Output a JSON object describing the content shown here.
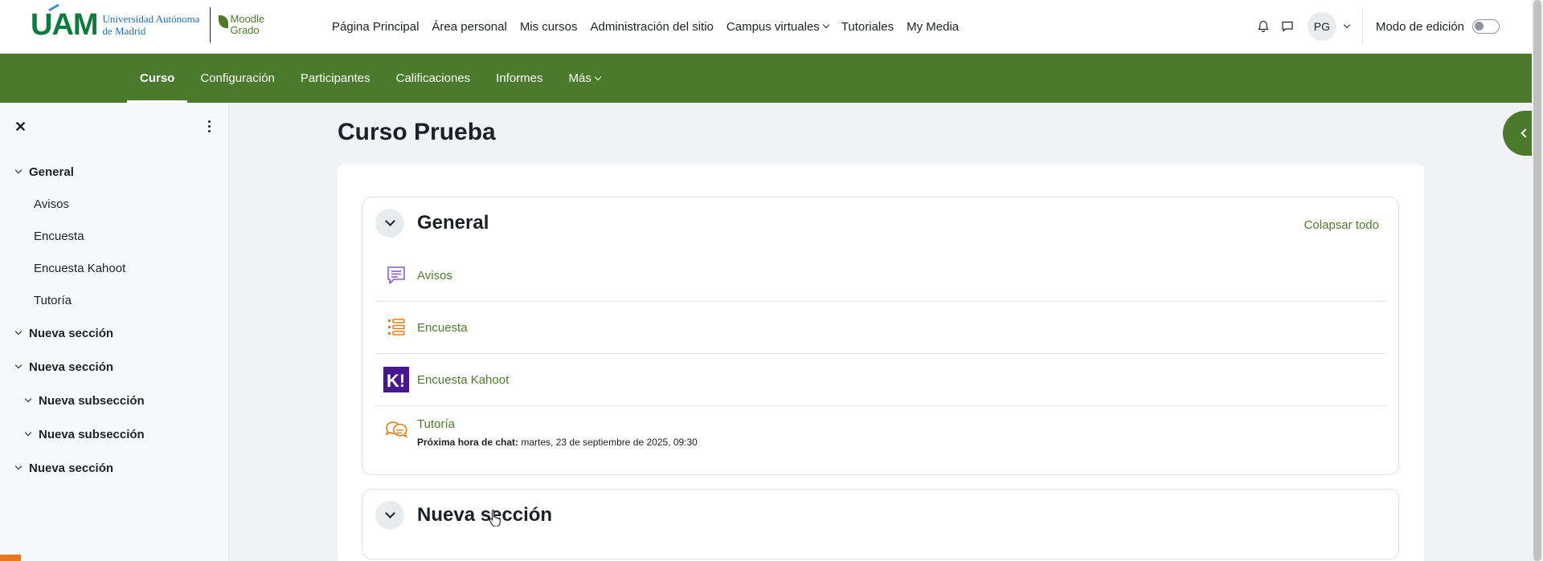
{
  "topbar": {
    "logo": {
      "uam": "UAM",
      "university_line1": "Universidad Autónoma",
      "university_line2": "de Madrid",
      "moodle_line1": "Moodle",
      "moodle_line2": "Grado"
    },
    "nav": [
      {
        "label": "Página Principal"
      },
      {
        "label": "Área personal"
      },
      {
        "label": "Mis cursos"
      },
      {
        "label": "Administración del sitio"
      },
      {
        "label": "Campus virtuales"
      },
      {
        "label": "Tutoriales"
      },
      {
        "label": "My Media"
      }
    ],
    "user_initials": "PG",
    "edit_mode_label": "Modo de edición",
    "edit_mode_on": false
  },
  "secondary_nav": {
    "items": [
      {
        "label": "Curso",
        "active": true
      },
      {
        "label": "Configuración"
      },
      {
        "label": "Participantes"
      },
      {
        "label": "Calificaciones"
      },
      {
        "label": "Informes"
      },
      {
        "label": "Más"
      }
    ]
  },
  "drawer": {
    "items": [
      {
        "label": "General"
      },
      {
        "label": "Avisos"
      },
      {
        "label": "Encuesta"
      },
      {
        "label": "Encuesta Kahoot"
      },
      {
        "label": "Tutoría"
      },
      {
        "label": "Nueva sección"
      },
      {
        "label": "Nueva sección"
      },
      {
        "label": "Nueva subsección"
      },
      {
        "label": "Nueva subsección"
      },
      {
        "label": "Nueva sección"
      }
    ]
  },
  "main": {
    "page_title": "Curso Prueba",
    "collapse_all": "Colapsar todo",
    "sections": [
      {
        "title": "General",
        "activities": [
          {
            "name": "Avisos",
            "icon": "forum-icon"
          },
          {
            "name": "Encuesta",
            "icon": "survey-icon"
          },
          {
            "name": "Encuesta Kahoot",
            "icon": "kahoot-icon"
          },
          {
            "name": "Tutoría",
            "icon": "chat-icon",
            "meta_label": "Próxima hora de chat:",
            "meta_value": " martes, 23 de septiembre de 2025, 09:30"
          }
        ]
      },
      {
        "title": "Nueva sección"
      }
    ]
  },
  "colors": {
    "brand_green": "#4a7a2c",
    "forum_purple": "#8e5cc5",
    "survey_orange": "#e37f16",
    "kahoot_purple": "#46178f"
  }
}
